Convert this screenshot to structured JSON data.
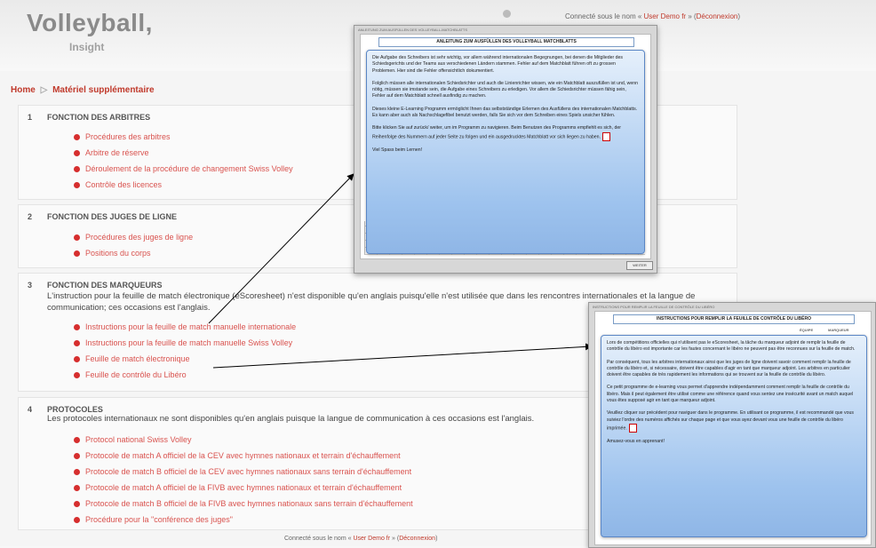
{
  "header": {
    "logo_main": "Volleyball,",
    "logo_sub": "Insight",
    "login_prefix": "Connecté sous le nom «",
    "login_user": "User Demo fr",
    "login_mid": "» (",
    "login_logout": "Déconnexion",
    "login_suffix": ")"
  },
  "breadcrumb": {
    "home": "Home",
    "separator": "▷",
    "current": "Matériel supplémentaire"
  },
  "sections": [
    {
      "number": "1",
      "title": "FONCTION DES ARBITRES",
      "links": [
        "Procédures des arbitres",
        "Arbitre de réserve",
        "Déroulement de la procédure de changement Swiss Volley",
        "Contrôle des licences"
      ]
    },
    {
      "number": "2",
      "title": "FONCTION DES JUGES DE LIGNE",
      "links": [
        "Procédures des juges de ligne",
        "Positions du corps"
      ]
    },
    {
      "number": "3",
      "title": "FONCTION DES MARQUEURS",
      "description": "L'instruction pour la feuille de match électronique (eScoresheet) n'est disponible qu'en anglais puisqu'elle n'est utilisée que dans les rencontres internationales et la langue de communication; ces occasions est l'anglais.",
      "links": [
        "Instructions pour la feuille de match manuelle internationale",
        "Instructions pour la feuille de match manuelle Swiss Volley",
        "Feuille de match électronique",
        "Feuille de contrôle du Libéro"
      ]
    },
    {
      "number": "4",
      "title": "PROTOCOLES",
      "description": "Les protocoles internationaux ne sont disponibles qu'en anglais puisque la langue de communication à ces occasions est l'anglais.",
      "links": [
        "Protocol national Swiss Volley",
        "Protocole de match A officiel de la CEV avec hymnes nationaux et terrain d'échauffement",
        "Protocole de match B officiel de la CEV avec hymnes nationaux sans terrain d'échauffement",
        "Protocole de match A officiel de la FIVB avec hymnes nationaux et terrain d'échauffement",
        "Protocole de match B officiel de la FIVB avec hymnes nationaux sans terrain d'échauffement",
        "Procédure pour la \"conférence des juges\""
      ]
    }
  ],
  "footer": {
    "prefix": "Connecté sous le nom «",
    "user": "User Demo fr",
    "mid": "» (",
    "logout": "Déconnexion",
    "suffix": ")"
  },
  "popup1": {
    "top_label": "ANLEITUNG ZUM AUSFÜLLEN DES VOLLEYBALL-MATCHBLATTS",
    "title": "ANLEITUNG ZUM AUSFÜLLEN DES VOLLEYBALL MATCHBLATTS",
    "paragraphs": [
      "Die Aufgabe des Schreibers ist sehr wichtig, vor allem während internationalen Begegnungen, bei denen die Mitglieder des Schiedsgerichts und der Teams aus verschiedenen Ländern stammen. Fehler auf dem Matchblatt führen oft zu grossen Problemen. Hier sind die Fehler offensichtlich dokumentiert.",
      "Folglich müssen alle internationalen Schiedsrichter und auch die Linienrichter wissen, wie ein Matchblatt auszufüllen ist und, wenn nötig, müssen sie imstande sein, die Aufgabe eines Schreibers zu erledigen. Vor allem die Schiedsrichter müssen fähig sein, Fehler auf dem Matchblatt schnell ausfindig zu machen.",
      "Dieses kleine E-Learning Programm ermöglicht Ihnen das selbstständige Erlernen des Ausfüllens des internationalen Matchblatts. Es kann aber auch als Nachschlagefibel benutzt werden, falls Sie sich vor dem Schreiben eines Spiels unsicher fühlen.",
      "Bitte klicken Sie auf zurück/ weiter, um im Programm zu navigieren. Beim Benutzen des Programms empfiehlt es sich, der Reihenfolge des Nummern auf jeder Seite zu folgen und ein ausgedrucktes Matchblatt vor sich liegen zu haben.",
      "Viel Spass beim Lernen!"
    ],
    "button": "WEITER"
  },
  "popup2": {
    "top_label": "INSTRUCTIONS POUR REMPLIR LA FEUILLE DE CONTRÔLE DU LIBÉRO",
    "title": "INSTRUCTIONS POUR REMPLIR LA FEUILLE DE CONTRÔLE DU LIBÉRO",
    "tab1": "ÉQUIPE",
    "tab2": "MARQUEUR",
    "paragraphs": [
      "Lors de compétitions officielles qui n'utilisent pas le eScoresheet, la tâche du marqueur adjoint de remplir la feuille de contrôle du libéro est importante car les fautes concernant le libéro ne peuvent pas être reconnues sur la feuille de match.",
      "Par conséquent, tous les arbitres internationaux ainsi que les juges de ligne doivent savoir comment remplir la feuille de contrôle du libéro et, si nécessaire, doivent être capables d'agir en tant que marqueur adjoint. Les arbitres en particulier doivent être capables de très rapidement les informations qui se trouvent sur la feuille de contrôle du libéro.",
      "Ce petit programme de e-learning vous permet d'apprendre indépendamment comment remplir la feuille de contrôle du libéro. Mais il peut également être utilisé comme une référence quand vous sentez une insécurité avant un match auquel vous êtes supposé agir en tant que marqueur adjoint.",
      "Veuillez cliquer sur précédent pour naviguer dans le programme. En utilisant ce programme, il est recommandé que vous suiviez l'ordre des numéros affichés sur chaque page et que vous ayez devant vous une feuille de contrôle du libéro imprimée.",
      "Amusez-vous en apprenant!"
    ]
  },
  "colors": {
    "link": "#d9534f",
    "bullet": "#d62e2e",
    "breadcrumb": "#c0392b",
    "popup_box": "#9ec3ee"
  }
}
